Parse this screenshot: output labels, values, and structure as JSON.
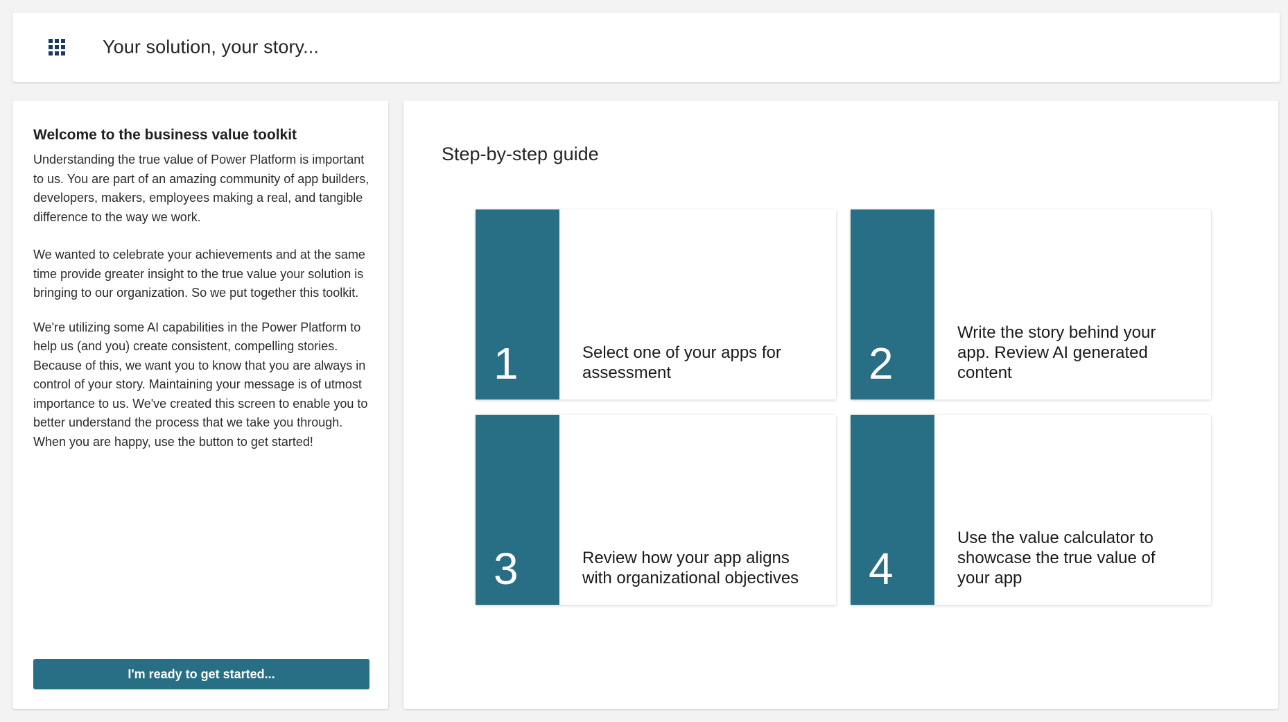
{
  "header": {
    "title": "Your solution, your story...",
    "menu_icon": "waffle-grid-icon"
  },
  "welcome": {
    "title": "Welcome to the business value toolkit",
    "paragraphs": [
      "Understanding the true value of Power Platform is important to us. You are part of an amazing community of app builders, developers, makers, employees making a real, and tangible difference to the way we work.",
      "We wanted to celebrate your achievements and at the same time provide greater insight to the true value your solution is bringing to our organization. So we put together this toolkit.",
      "We're utilizing some AI capabilities in the Power Platform to help us (and you) create consistent, compelling stories. Because of this, we want you to know that you are always in control of your story. Maintaining your message is of utmost importance to us. We've created this screen to enable you to better understand the process that we take you through. When you are happy, use the button to get started!"
    ],
    "button_label": "I'm ready to get started..."
  },
  "guide": {
    "title": "Step-by-step guide",
    "steps": [
      {
        "number": "1",
        "text": "Select one of your apps for assessment"
      },
      {
        "number": "2",
        "text": "Write the story behind your app. Review AI generated content"
      },
      {
        "number": "3",
        "text": "Review how your app aligns with organizational objectives"
      },
      {
        "number": "4",
        "text": "Use the value calculator to showcase the true value of your app"
      }
    ]
  },
  "colors": {
    "accent": "#286e84",
    "background": "#f3f3f3",
    "panel": "#ffffff",
    "icon": "#1c3a5c"
  }
}
